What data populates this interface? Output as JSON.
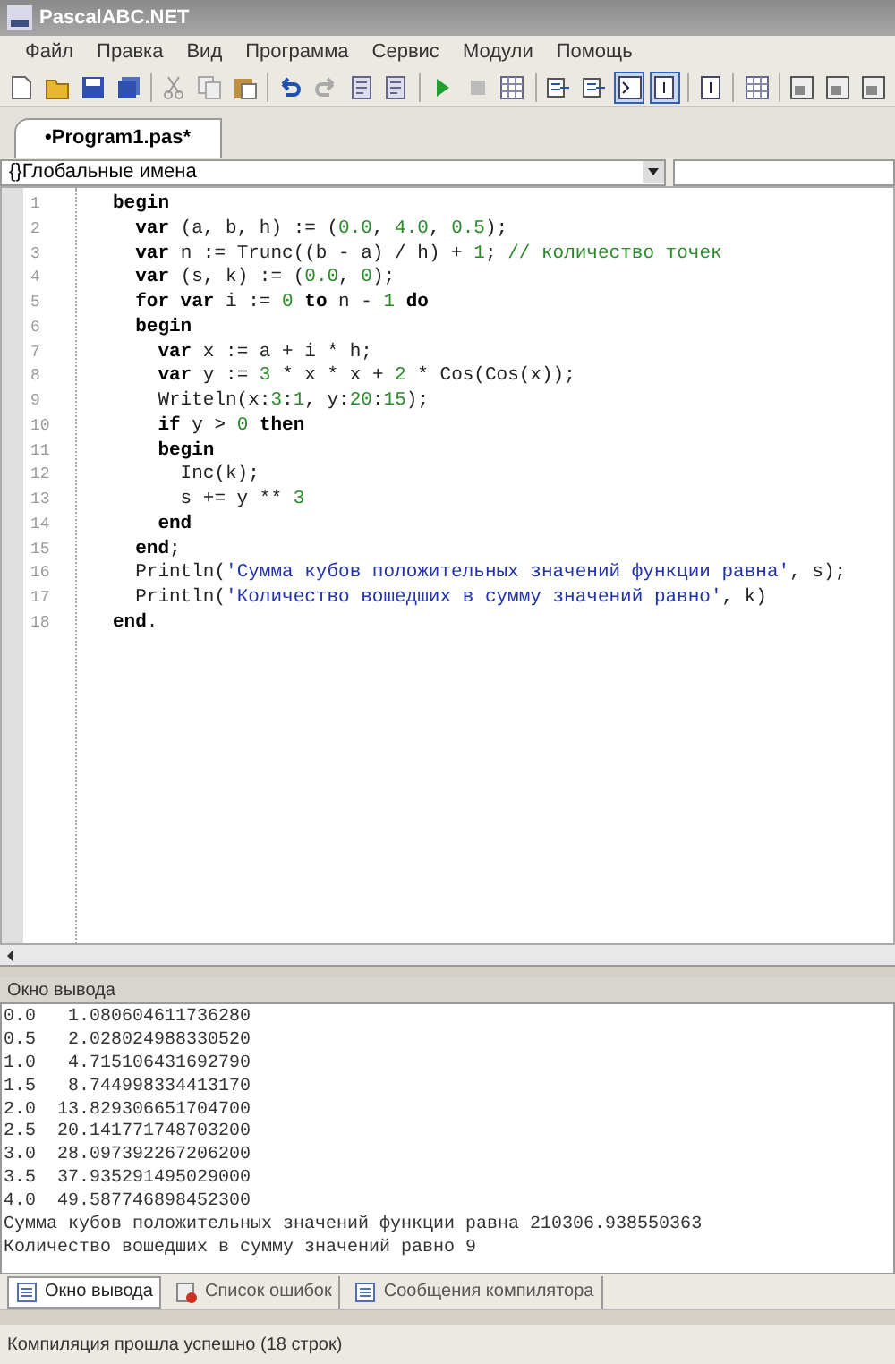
{
  "window": {
    "title": "PascalABC.NET"
  },
  "menu": [
    "Файл",
    "Правка",
    "Вид",
    "Программа",
    "Сервис",
    "Модули",
    "Помощь"
  ],
  "toolbar": [
    {
      "kind": "new",
      "pressed": false
    },
    {
      "kind": "open",
      "pressed": false
    },
    {
      "kind": "save",
      "pressed": false
    },
    {
      "kind": "saveall",
      "pressed": false
    },
    {
      "kind": "sep"
    },
    {
      "kind": "cut",
      "pressed": false
    },
    {
      "kind": "copy",
      "pressed": false
    },
    {
      "kind": "paste",
      "pressed": false
    },
    {
      "kind": "sep"
    },
    {
      "kind": "undo",
      "pressed": false
    },
    {
      "kind": "redo",
      "pressed": false
    },
    {
      "kind": "doc",
      "pressed": false
    },
    {
      "kind": "doc",
      "pressed": false
    },
    {
      "kind": "sep"
    },
    {
      "kind": "run",
      "pressed": false
    },
    {
      "kind": "stop",
      "pressed": false
    },
    {
      "kind": "grid",
      "pressed": false
    },
    {
      "kind": "sep"
    },
    {
      "kind": "list",
      "pressed": false
    },
    {
      "kind": "list",
      "pressed": false
    },
    {
      "kind": "console",
      "pressed": true
    },
    {
      "kind": "page",
      "pressed": true
    },
    {
      "kind": "sep"
    },
    {
      "kind": "page",
      "pressed": false
    },
    {
      "kind": "sep"
    },
    {
      "kind": "grid",
      "pressed": false
    },
    {
      "kind": "sep"
    },
    {
      "kind": "window",
      "pressed": false
    },
    {
      "kind": "window",
      "pressed": false
    },
    {
      "kind": "window",
      "pressed": false
    }
  ],
  "file_tabs": [
    {
      "label": "•Program1.pas*",
      "selected": true
    }
  ],
  "scope_dropdown": {
    "value": "{}Глобальные имена"
  },
  "code": [
    {
      "number": "1",
      "tokens": [
        {
          "kind": "keyword",
          "text": "begin"
        }
      ]
    },
    {
      "number": "2",
      "tokens": [
        {
          "kind": "keyword",
          "text": "  var"
        },
        {
          "kind": "plain",
          "text": " (a, b, h) := ("
        },
        {
          "kind": "number",
          "text": "0.0"
        },
        {
          "kind": "plain",
          "text": ", "
        },
        {
          "kind": "number",
          "text": "4.0"
        },
        {
          "kind": "plain",
          "text": ", "
        },
        {
          "kind": "number",
          "text": "0.5"
        },
        {
          "kind": "plain",
          "text": ");"
        }
      ]
    },
    {
      "number": "3",
      "tokens": [
        {
          "kind": "keyword",
          "text": "  var"
        },
        {
          "kind": "plain",
          "text": " n := Trunc((b - a) / h) + "
        },
        {
          "kind": "number",
          "text": "1"
        },
        {
          "kind": "plain",
          "text": "; "
        },
        {
          "kind": "comment",
          "text": "// количество точек"
        }
      ]
    },
    {
      "number": "4",
      "tokens": [
        {
          "kind": "keyword",
          "text": "  var"
        },
        {
          "kind": "plain",
          "text": " (s, k) := ("
        },
        {
          "kind": "number",
          "text": "0.0"
        },
        {
          "kind": "plain",
          "text": ", "
        },
        {
          "kind": "number",
          "text": "0"
        },
        {
          "kind": "plain",
          "text": ");"
        }
      ]
    },
    {
      "number": "5",
      "tokens": [
        {
          "kind": "keyword",
          "text": "  for var"
        },
        {
          "kind": "plain",
          "text": " i := "
        },
        {
          "kind": "number",
          "text": "0"
        },
        {
          "kind": "keyword",
          "text": " to"
        },
        {
          "kind": "plain",
          "text": " n - "
        },
        {
          "kind": "number",
          "text": "1"
        },
        {
          "kind": "keyword",
          "text": " do"
        }
      ]
    },
    {
      "number": "6",
      "tokens": [
        {
          "kind": "keyword",
          "text": "  begin"
        }
      ]
    },
    {
      "number": "7",
      "tokens": [
        {
          "kind": "keyword",
          "text": "    var"
        },
        {
          "kind": "plain",
          "text": " x := a + i * h;"
        }
      ]
    },
    {
      "number": "8",
      "tokens": [
        {
          "kind": "keyword",
          "text": "    var"
        },
        {
          "kind": "plain",
          "text": " y := "
        },
        {
          "kind": "number",
          "text": "3"
        },
        {
          "kind": "plain",
          "text": " * x * x + "
        },
        {
          "kind": "number",
          "text": "2"
        },
        {
          "kind": "plain",
          "text": " * Cos(Cos(x));"
        }
      ]
    },
    {
      "number": "9",
      "tokens": [
        {
          "kind": "plain",
          "text": "    Writeln(x:"
        },
        {
          "kind": "number",
          "text": "3"
        },
        {
          "kind": "plain",
          "text": ":"
        },
        {
          "kind": "number",
          "text": "1"
        },
        {
          "kind": "plain",
          "text": ", y:"
        },
        {
          "kind": "number",
          "text": "20"
        },
        {
          "kind": "plain",
          "text": ":"
        },
        {
          "kind": "number",
          "text": "15"
        },
        {
          "kind": "plain",
          "text": ");"
        }
      ]
    },
    {
      "number": "10",
      "tokens": [
        {
          "kind": "keyword",
          "text": "    if"
        },
        {
          "kind": "plain",
          "text": " y > "
        },
        {
          "kind": "number",
          "text": "0"
        },
        {
          "kind": "keyword",
          "text": " then"
        }
      ]
    },
    {
      "number": "11",
      "tokens": [
        {
          "kind": "keyword",
          "text": "    begin"
        }
      ]
    },
    {
      "number": "12",
      "tokens": [
        {
          "kind": "plain",
          "text": "      Inc(k);"
        }
      ]
    },
    {
      "number": "13",
      "tokens": [
        {
          "kind": "plain",
          "text": "      s += y ** "
        },
        {
          "kind": "number",
          "text": "3"
        }
      ]
    },
    {
      "number": "14",
      "tokens": [
        {
          "kind": "keyword",
          "text": "    end"
        }
      ]
    },
    {
      "number": "15",
      "tokens": [
        {
          "kind": "keyword",
          "text": "  end"
        },
        {
          "kind": "plain",
          "text": ";"
        }
      ]
    },
    {
      "number": "16",
      "tokens": [
        {
          "kind": "plain",
          "text": "  Println("
        },
        {
          "kind": "string",
          "text": "'Сумма кубов положительных значений функции равна'"
        },
        {
          "kind": "plain",
          "text": ", s);"
        }
      ]
    },
    {
      "number": "17",
      "tokens": [
        {
          "kind": "plain",
          "text": "  Println("
        },
        {
          "kind": "string",
          "text": "'Количество вошедших в сумму значений равно'"
        },
        {
          "kind": "plain",
          "text": ", k)"
        }
      ]
    },
    {
      "number": "18",
      "tokens": [
        {
          "kind": "keyword",
          "text": "end"
        },
        {
          "kind": "plain",
          "text": "."
        }
      ]
    }
  ],
  "output_panel": {
    "title": "Окно вывода",
    "lines": [
      "0.0   1.080604611736280",
      "0.5   2.028024988330520",
      "1.0   4.715106431692790",
      "1.5   8.744998334413170",
      "2.0  13.829306651704700",
      "2.5  20.141771748703200",
      "3.0  28.097392267206200",
      "3.5  37.935291495029000",
      "4.0  49.587746898452300",
      "Сумма кубов положительных значений функции равна 210306.938550363",
      "Количество вошедших в сумму значений равно 9"
    ]
  },
  "bottom_tabs": [
    {
      "label": "Окно вывода",
      "kind": "output",
      "selected": true
    },
    {
      "label": "Список ошибок",
      "kind": "errors",
      "selected": false
    },
    {
      "label": "Сообщения компилятора",
      "kind": "messages",
      "selected": false
    }
  ],
  "status_bar": "Компиляция прошла успешно (18 строк)"
}
